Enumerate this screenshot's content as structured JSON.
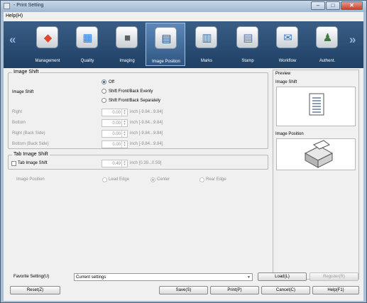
{
  "window": {
    "title": "- Print Setting",
    "minimize": "–",
    "maximize": "□",
    "close": "✕"
  },
  "menu": {
    "help": "Help(H)"
  },
  "nav": {
    "prev": "«",
    "next": "»"
  },
  "tabs": [
    {
      "label": "Management",
      "icon": "management-icon",
      "glyph": "◆",
      "color": "#d84a2b"
    },
    {
      "label": "Quality",
      "icon": "quality-icon",
      "glyph": "▦",
      "color": "#2b7fd8"
    },
    {
      "label": "Imaging",
      "icon": "imaging-icon",
      "glyph": "■",
      "color": "#606060"
    },
    {
      "label": "Image Position",
      "icon": "image-position-icon",
      "glyph": "▤",
      "color": "#1f4f86"
    },
    {
      "label": "Marks",
      "icon": "marks-icon",
      "glyph": "▥",
      "color": "#4a6f9a"
    },
    {
      "label": "Stamp",
      "icon": "stamp-icon",
      "glyph": "▤",
      "color": "#5577a8"
    },
    {
      "label": "Workflow",
      "icon": "workflow-icon",
      "glyph": "✉",
      "color": "#3a77b8"
    },
    {
      "label": "Authent.",
      "icon": "authentication-icon",
      "glyph": "♟",
      "color": "#3a7a3a"
    }
  ],
  "image_shift": {
    "group_title": "Image Shift",
    "row_label": "Image Shift",
    "options": [
      "Off",
      "Shift Front/Back Evenly",
      "Shift Front/Back Separately"
    ],
    "selected": "Off",
    "fields": [
      {
        "label": "Right",
        "value": "0.00",
        "range": "inch [-9.84...9.84]"
      },
      {
        "label": "Bottom",
        "value": "0.00",
        "range": "inch [-9.84...9.84]"
      },
      {
        "label": "Right (Back Side)",
        "value": "0.00",
        "range": "inch [-9.84...9.84]"
      },
      {
        "label": "Bottom (Back Side)",
        "value": "0.00",
        "range": "inch [-9.84...9.84]"
      }
    ]
  },
  "tab_image_shift": {
    "group_title": "Tab Image Shift",
    "checkbox_label": "Tab Image Shift",
    "checked": false,
    "value": "0.49",
    "range": "inch [0.39...0.59]"
  },
  "image_position": {
    "label": "Image Position",
    "options": [
      "Lead Edge",
      "Center",
      "Rear Edge"
    ],
    "selected": "Center"
  },
  "preview": {
    "title": "Preview",
    "image_shift_title": "Image Shift",
    "image_position_title": "Image Position"
  },
  "favorite": {
    "label": "Favorite Setting(U)",
    "value": "Current settings",
    "load": "Load(L)",
    "register": "Register(R)"
  },
  "buttons": {
    "reset": "Reset(Z)",
    "save": "Save(S)",
    "print": "Print(P)",
    "cancel": "Cancel(C)",
    "help": "Help(F1)"
  }
}
